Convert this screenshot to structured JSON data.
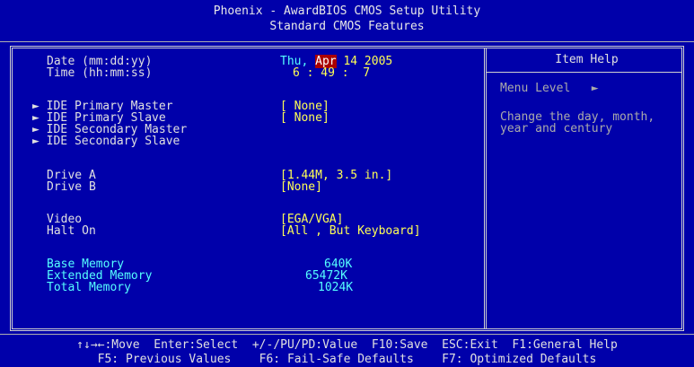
{
  "header": {
    "title": "Phoenix - AwardBIOS CMOS Setup Utility",
    "subtitle": "Standard CMOS Features"
  },
  "fields": {
    "date_label": "Date (mm:dd:yy)",
    "time_label": "Time (hh:mm:ss)",
    "ide_primary_master": "IDE Primary Master",
    "ide_primary_slave": "IDE Primary Slave",
    "ide_secondary_master": "IDE Secondary Master",
    "ide_secondary_slave": "IDE Secondary Slave",
    "drive_a": "Drive A",
    "drive_b": "Drive B",
    "video": "Video",
    "halt_on": "Halt On",
    "base_memory": "Base Memory",
    "extended_memory": "Extended Memory",
    "total_memory": "Total Memory"
  },
  "values": {
    "date_day": "Thu,",
    "date_month": "Apr",
    "date_rest": "14 2005",
    "time": "6 : 49 :  7",
    "ide_primary_master": "[ None]",
    "ide_primary_slave": "[ None]",
    "drive_a": "[1.44M, 3.5 in.]",
    "drive_b": "[None]",
    "video": "[EGA/VGA]",
    "halt_on": "[All , But Keyboard]",
    "base_memory": "640K",
    "extended_memory": "65472K",
    "total_memory": "1024K"
  },
  "help": {
    "title": "Item Help",
    "menu_level": "Menu Level",
    "menu_level_arrow": "►",
    "text_line1": "Change the day, month,",
    "text_line2": "year and century"
  },
  "footer": {
    "line1": "↑↓→←:Move  Enter:Select  +/-/PU/PD:Value  F10:Save  ESC:Exit  F1:General Help",
    "line2": "F5: Previous Values    F6: Fail-Safe Defaults    F7: Optimized Defaults"
  }
}
